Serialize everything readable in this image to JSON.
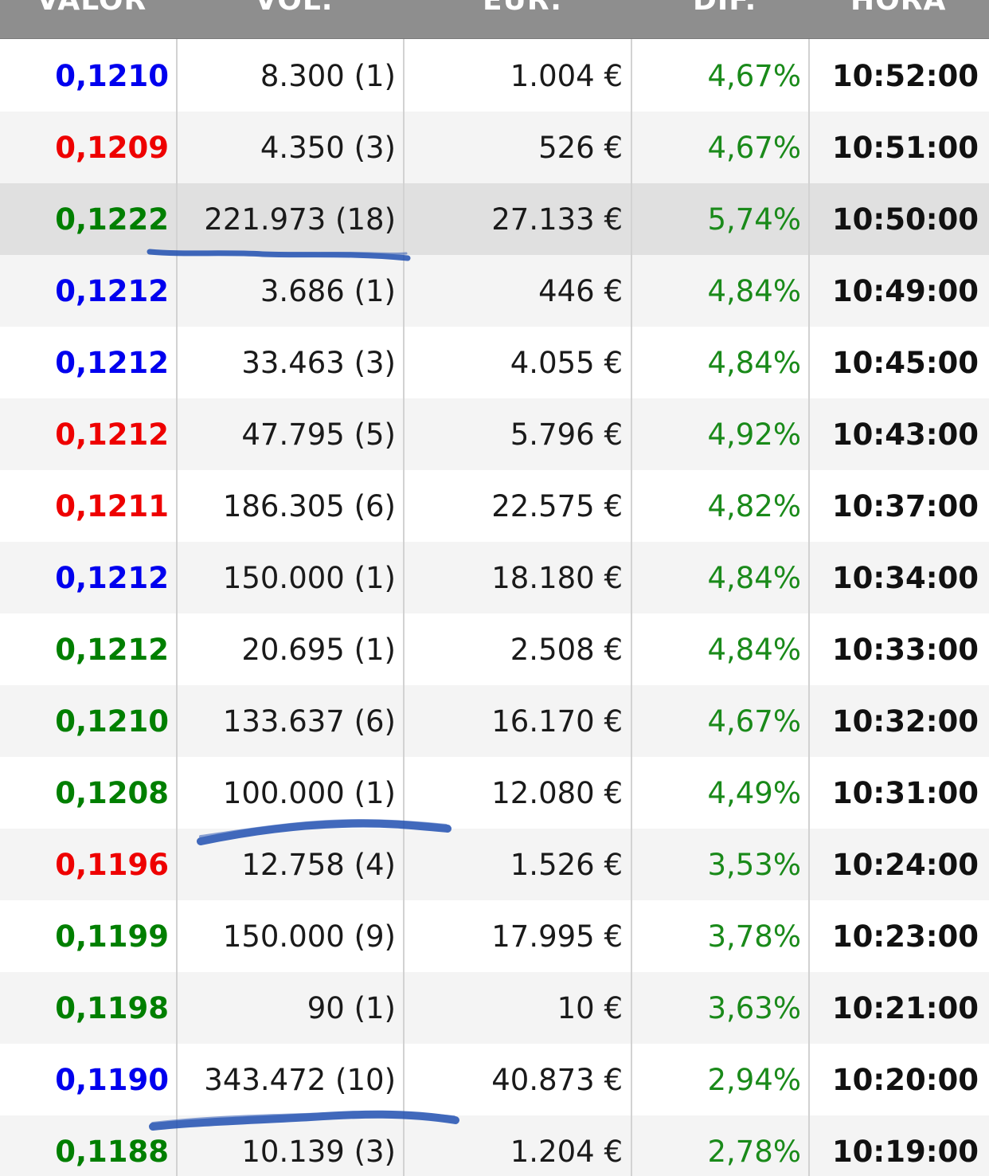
{
  "colors": {
    "header_bg": "#8e8e8e",
    "up": "#007f00",
    "down": "#ee0000",
    "neutral": "#0000ee",
    "dif": "#1a8a1a",
    "highlight_row": "#e0e0e0",
    "pen_marks": "#1f4fb0"
  },
  "header": {
    "valor": "VALOR",
    "vol": "VOL.",
    "eur": "EUR.",
    "dif": "DIF.",
    "hora": "HORA"
  },
  "rows": [
    {
      "valor": "0,1210",
      "color": "blue",
      "vol": "8.300 (1)",
      "eur": "1.004 €",
      "dif": "4,67%",
      "hora": "10:52:00"
    },
    {
      "valor": "0,1209",
      "color": "red",
      "vol": "4.350 (3)",
      "eur": "526 €",
      "dif": "4,67%",
      "hora": "10:51:00"
    },
    {
      "valor": "0,1222",
      "color": "green",
      "vol": "221.973 (18)",
      "eur": "27.133 €",
      "dif": "5,74%",
      "hora": "10:50:00",
      "highlighted": true
    },
    {
      "valor": "0,1212",
      "color": "blue",
      "vol": "3.686 (1)",
      "eur": "446 €",
      "dif": "4,84%",
      "hora": "10:49:00"
    },
    {
      "valor": "0,1212",
      "color": "blue",
      "vol": "33.463 (3)",
      "eur": "4.055 €",
      "dif": "4,84%",
      "hora": "10:45:00"
    },
    {
      "valor": "0,1212",
      "color": "red",
      "vol": "47.795 (5)",
      "eur": "5.796 €",
      "dif": "4,92%",
      "hora": "10:43:00"
    },
    {
      "valor": "0,1211",
      "color": "red",
      "vol": "186.305 (6)",
      "eur": "22.575 €",
      "dif": "4,82%",
      "hora": "10:37:00"
    },
    {
      "valor": "0,1212",
      "color": "blue",
      "vol": "150.000 (1)",
      "eur": "18.180 €",
      "dif": "4,84%",
      "hora": "10:34:00"
    },
    {
      "valor": "0,1212",
      "color": "green",
      "vol": "20.695 (1)",
      "eur": "2.508 €",
      "dif": "4,84%",
      "hora": "10:33:00"
    },
    {
      "valor": "0,1210",
      "color": "green",
      "vol": "133.637 (6)",
      "eur": "16.170 €",
      "dif": "4,67%",
      "hora": "10:32:00"
    },
    {
      "valor": "0,1208",
      "color": "green",
      "vol": "100.000 (1)",
      "eur": "12.080 €",
      "dif": "4,49%",
      "hora": "10:31:00"
    },
    {
      "valor": "0,1196",
      "color": "red",
      "vol": "12.758 (4)",
      "eur": "1.526 €",
      "dif": "3,53%",
      "hora": "10:24:00"
    },
    {
      "valor": "0,1199",
      "color": "green",
      "vol": "150.000 (9)",
      "eur": "17.995 €",
      "dif": "3,78%",
      "hora": "10:23:00"
    },
    {
      "valor": "0,1198",
      "color": "green",
      "vol": "90 (1)",
      "eur": "10 €",
      "dif": "3,63%",
      "hora": "10:21:00"
    },
    {
      "valor": "0,1190",
      "color": "blue",
      "vol": "343.472 (10)",
      "eur": "40.873 €",
      "dif": "2,94%",
      "hora": "10:20:00"
    },
    {
      "valor": "0,1188",
      "color": "green",
      "vol": "10.139 (3)",
      "eur": "1.204 €",
      "dif": "2,78%",
      "hora": "10:19:00"
    }
  ]
}
